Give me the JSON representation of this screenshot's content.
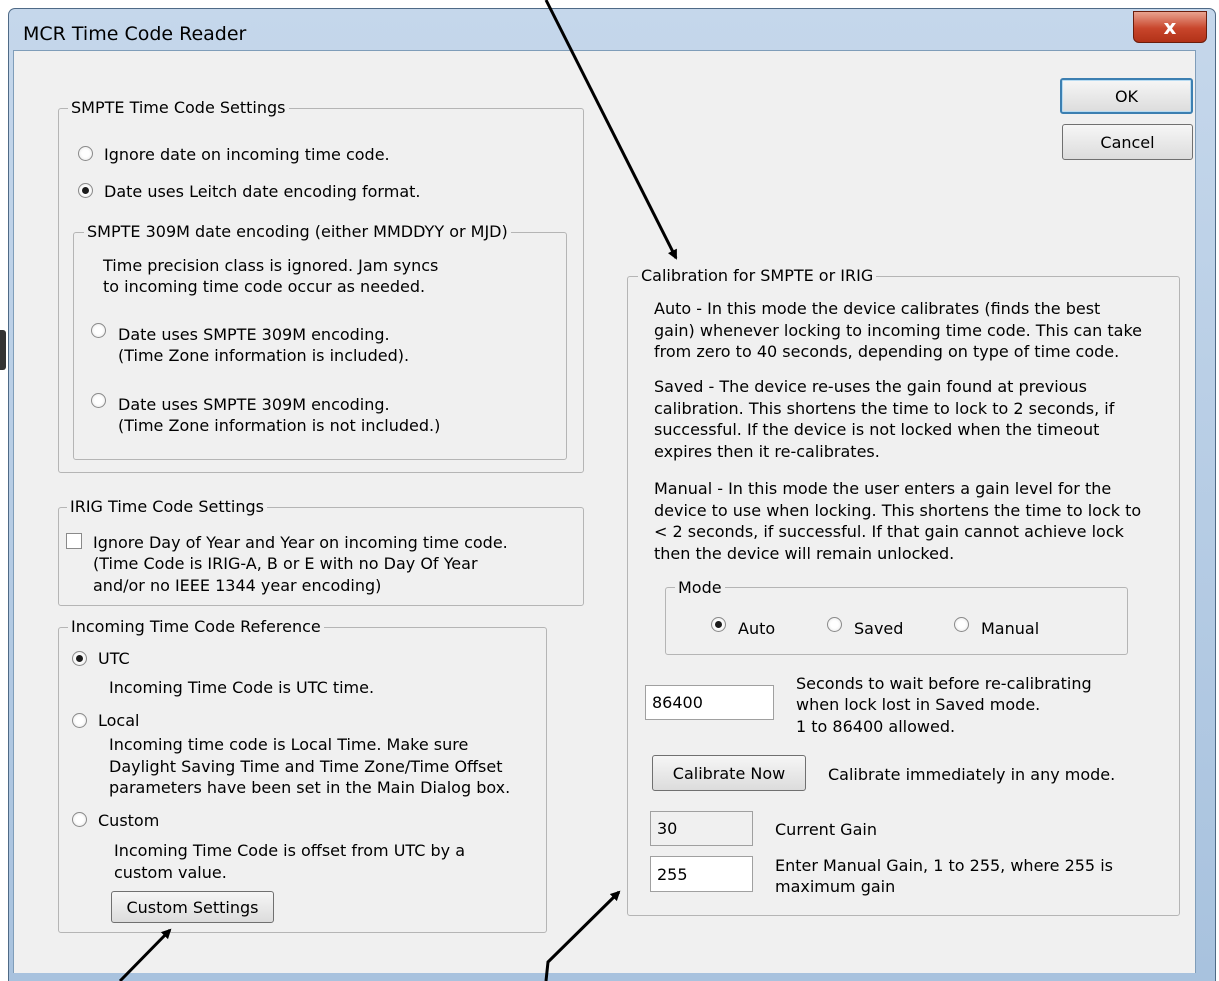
{
  "window": {
    "title": "MCR Time Code Reader",
    "close_glyph": "x"
  },
  "buttons": {
    "ok": "OK",
    "cancel": "Cancel"
  },
  "smpte": {
    "legend": "SMPTE Time Code Settings",
    "options": [
      {
        "label": "Ignore date on incoming time code.",
        "selected": false
      },
      {
        "label": "Date uses Leitch date encoding format.",
        "selected": true
      }
    ],
    "sub": {
      "legend": "SMPTE 309M date encoding (either MMDDYY or MJD)",
      "note": [
        "Time precision class is ignored. Jam syncs",
        "to incoming time code occur as needed."
      ],
      "options": [
        {
          "label": "Date uses SMPTE 309M encoding.",
          "detail": "(Time Zone information is included).",
          "selected": false
        },
        {
          "label": "Date uses SMPTE 309M encoding.",
          "detail": "(Time Zone information is not included.)",
          "selected": false
        }
      ]
    }
  },
  "irig": {
    "legend": "IRIG Time Code Settings",
    "checkbox_label": "Ignore Day of Year and Year on incoming time code.",
    "checked": false,
    "detail": [
      "(Time Code is IRIG-A, B or E with no Day Of Year",
      "and/or no IEEE 1344 year encoding)"
    ]
  },
  "reference": {
    "legend": "Incoming Time Code Reference",
    "options": [
      {
        "label": "UTC",
        "selected": true,
        "desc": [
          "Incoming Time Code is UTC time."
        ]
      },
      {
        "label": "Local",
        "selected": false,
        "desc": [
          "Incoming time code is Local Time. Make sure",
          "Daylight Saving Time and Time Zone/Time Offset",
          "parameters have been set in the Main Dialog box."
        ]
      },
      {
        "label": "Custom",
        "selected": false,
        "desc": [
          "Incoming Time Code is offset from UTC by a",
          "custom value."
        ]
      }
    ],
    "custom_button": "Custom Settings"
  },
  "calibration": {
    "legend": "Calibration for SMPTE or IRIG",
    "auto_text": [
      "Auto - In this mode the device calibrates (finds the best",
      "gain) whenever locking to incoming time code. This can take",
      "from zero to 40 seconds, depending on type of time code."
    ],
    "saved_text": [
      "Saved - The device re-uses the gain found at previous",
      "calibration. This shortens the time to lock to 2 seconds, if",
      "successful. If the device is not locked when the timeout",
      "expires then it re-calibrates."
    ],
    "manual_text": [
      "Manual - In this mode the user enters a gain level for the",
      "device to use when locking. This shortens the time to lock to",
      "< 2 seconds, if successful. If that gain cannot achieve lock",
      "then the device will remain unlocked."
    ],
    "mode": {
      "legend": "Mode",
      "options": [
        {
          "label": "Auto",
          "selected": true
        },
        {
          "label": "Saved",
          "selected": false
        },
        {
          "label": "Manual",
          "selected": false
        }
      ]
    },
    "wait_value": "86400",
    "wait_label": [
      "Seconds to wait before re-calibrating",
      "when lock lost in Saved mode.",
      "1 to 86400 allowed."
    ],
    "calibrate_button": "Calibrate Now",
    "calibrate_label": "Calibrate immediately in any mode.",
    "current_gain_value": "30",
    "current_gain_label": "Current Gain",
    "manual_gain_value": "255",
    "manual_gain_label": [
      "Enter Manual Gain, 1 to 255, where 255 is",
      "maximum gain"
    ]
  }
}
